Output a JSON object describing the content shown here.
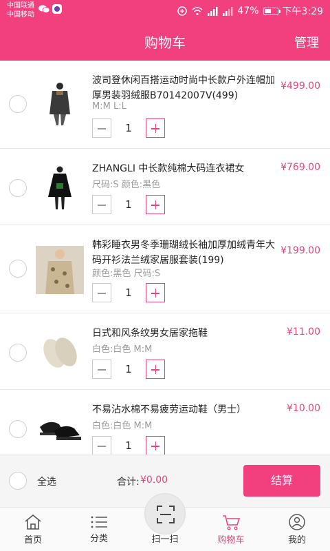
{
  "status_bar": {
    "carrier_1": "中国联通",
    "carrier_2": "中国移动",
    "battery": "47%",
    "time": "下午3:29"
  },
  "header": {
    "title": "购物车",
    "manage": "管理"
  },
  "cart": {
    "items": [
      {
        "name": "波司登休闲百搭运动时尚中长款户外连帽加厚男装羽绒服B70142007V(499)",
        "spec": "M:M L:L",
        "price": "¥499.00",
        "qty": "1",
        "image": "black-down-coat-photo"
      },
      {
        "name": "ZHANGLI 中长款纯棉大码连衣裙女",
        "spec": "尺码:S 颜色:黑色",
        "price": "¥769.00",
        "qty": "1",
        "image": "black-long-dress-photo"
      },
      {
        "name": "韩彩睡衣男冬季珊瑚绒长袖加厚加绒青年大码开衫法兰绒家居服套装(199)",
        "spec": "颜色:黑色 尺码:S",
        "price": "¥199.00",
        "qty": "1",
        "image": "patterned-pajamas-photo"
      },
      {
        "name": "日式和风条纹男女居家拖鞋",
        "spec": "白色:白色 M:M",
        "price": "¥11.00",
        "qty": "1",
        "image": "beige-slippers-photo"
      },
      {
        "name": "不易沾水棉不易疲劳运动鞋（男士）",
        "spec": "白色:白色 M:M",
        "price": "¥10.00",
        "qty": "1",
        "image": "black-sneakers-photo"
      }
    ]
  },
  "footer": {
    "select_all": "全选",
    "total_label": "合计:",
    "total_value": "¥0.00",
    "checkout": "结算"
  },
  "tabs": [
    {
      "label": "首页",
      "icon": "home-icon"
    },
    {
      "label": "分类",
      "icon": "list-icon"
    },
    {
      "label": "扫一扫",
      "icon": "scan-icon"
    },
    {
      "label": "购物车",
      "icon": "cart-icon",
      "active": true
    },
    {
      "label": "我的",
      "icon": "user-icon"
    }
  ],
  "colors": {
    "brand": "#f23f7d",
    "price": "#e0467f"
  }
}
